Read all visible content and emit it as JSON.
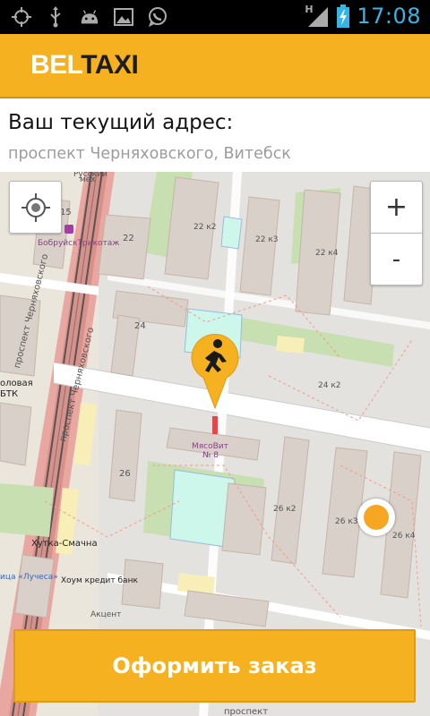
{
  "status_bar": {
    "time": "17:08",
    "network": "H",
    "left_icons": [
      "gps-icon",
      "usb-icon",
      "android-icon",
      "image-icon",
      "whatsapp-icon"
    ],
    "right_icons": [
      "signal-icon",
      "battery-icon"
    ]
  },
  "app_bar": {
    "brand_part1": "BEL",
    "brand_part2": "TAXI",
    "brand_color": "#f6b121"
  },
  "address": {
    "title": "Ваш текущий адрес:",
    "value": "проспект Черняховского, Витебск"
  },
  "map": {
    "zoom_in_label": "+",
    "zoom_out_label": "-",
    "labels": {
      "street1": "проспект Черняховского",
      "street2": "проспект Черняховского",
      "bobr": "БобруйскТрикотаж",
      "mikovit": "МясоВит",
      "mikovit_no": "№ 8",
      "hutka": "Хутка-Смачна",
      "houm": "Хоум кредит банк",
      "akcent": "Акцент",
      "lucheca": "ица «Лучеса»",
      "stolovaya": "оловая",
      "btk": "БТК",
      "bottom_street": "проспект",
      "top_cut": "Русский",
      "top_cut2": "мех",
      "b15": "15",
      "b22": "22",
      "b22k2": "22 к2",
      "b22k3": "22 к3",
      "b22k4": "22 к4",
      "b24": "24",
      "b24k2": "24 к2",
      "b26": "26",
      "b26k2": "26 к2",
      "b26k3": "26 к3",
      "b26k4": "26 к4"
    }
  },
  "order_button": {
    "label": "Оформить заказ"
  }
}
